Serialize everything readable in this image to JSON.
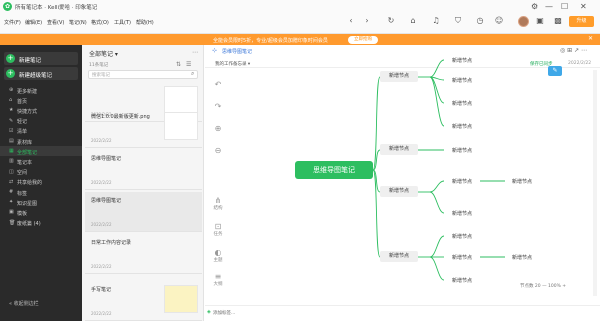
{
  "window": {
    "title": "所有笔记本 · Kelli爱哈 · 印象笔记"
  },
  "menu": [
    "文件(F)",
    "编辑(E)",
    "查看(V)",
    "笔记(N)",
    "格式(O)",
    "工具(T)",
    "帮助(H)"
  ],
  "toolbar": {
    "upgrade_label": "升级"
  },
  "promo": {
    "text": "全能会员限时5折，专业/超级会员加赠印象时间会员",
    "button": "立即抢购"
  },
  "sidebar": {
    "new_note": "新建笔记",
    "new_mindmap": "新建超级笔记",
    "items": [
      {
        "label": "更多新建",
        "icon": "⊕"
      },
      {
        "label": "首页",
        "icon": "⌂"
      },
      {
        "label": "快捷方式",
        "icon": "★"
      },
      {
        "label": "轻记",
        "icon": "✎"
      },
      {
        "label": "清单",
        "icon": "☑"
      },
      {
        "label": "素材库",
        "icon": "▤"
      },
      {
        "label": "全部笔记",
        "icon": "▦",
        "active": true
      },
      {
        "label": "笔记本",
        "icon": "▥"
      },
      {
        "label": "空间",
        "icon": "◫"
      },
      {
        "label": "共享给我的",
        "icon": "⇄"
      },
      {
        "label": "标签",
        "icon": "#"
      },
      {
        "label": "知识星图",
        "icon": "✦"
      },
      {
        "label": "模板",
        "icon": "▣"
      },
      {
        "label": "废纸篓   (4)",
        "icon": "🗑"
      }
    ],
    "collapse": "« 收起侧边栏"
  },
  "notelist": {
    "title": "全部笔记 ▾",
    "count": "11条笔记",
    "search_placeholder": "搜索笔记",
    "notes": [
      {
        "title": "",
        "date": "2022/2/22"
      },
      {
        "title": "微信1.0.0最新版更新.png",
        "date": "2022/2/22"
      },
      {
        "title": "思维导图笔记",
        "date": "2022/2/22"
      },
      {
        "title": "思维导图笔记",
        "date": "2022/2/22"
      },
      {
        "title": "日常工作内容记录",
        "date": "2022/2/22"
      },
      {
        "title": "手写笔记",
        "date": "2022/2/22"
      }
    ]
  },
  "editor": {
    "title": "思维导图笔记",
    "notebook": "我的工作备忘录 ▾",
    "meta": "保存已同步",
    "date": "2022/2/22",
    "rail": [
      {
        "label": "结构",
        "glyph": "⋔"
      },
      {
        "label": "任务",
        "glyph": "⊡"
      },
      {
        "label": "主题",
        "glyph": "◐"
      },
      {
        "label": "大纲",
        "glyph": "≡"
      }
    ],
    "badge": "会员",
    "zoom": "节点数 20   —   100%   +",
    "bottom": "添加标签..."
  },
  "mindmap": {
    "root": "思维导图笔记",
    "node_label": "新增节点"
  }
}
